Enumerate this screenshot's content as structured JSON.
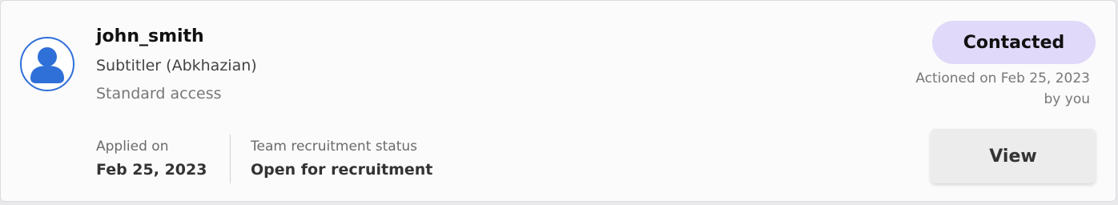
{
  "applicant": {
    "username": "john_smith",
    "role": "Subtitler (Abkhazian)",
    "access": "Standard access",
    "avatar_icon": "user-avatar-icon",
    "avatar_color": "#2f6fd8"
  },
  "applied": {
    "label": "Applied on",
    "value": "Feb 25, 2023"
  },
  "recruitment": {
    "label": "Team recruitment status",
    "value": "Open for recruitment"
  },
  "status": {
    "label": "Contacted",
    "color": "#e0d9f9",
    "actioned_line1": "Actioned on Feb 25, 2023",
    "actioned_line2": "by you"
  },
  "actions": {
    "view_label": "View"
  }
}
